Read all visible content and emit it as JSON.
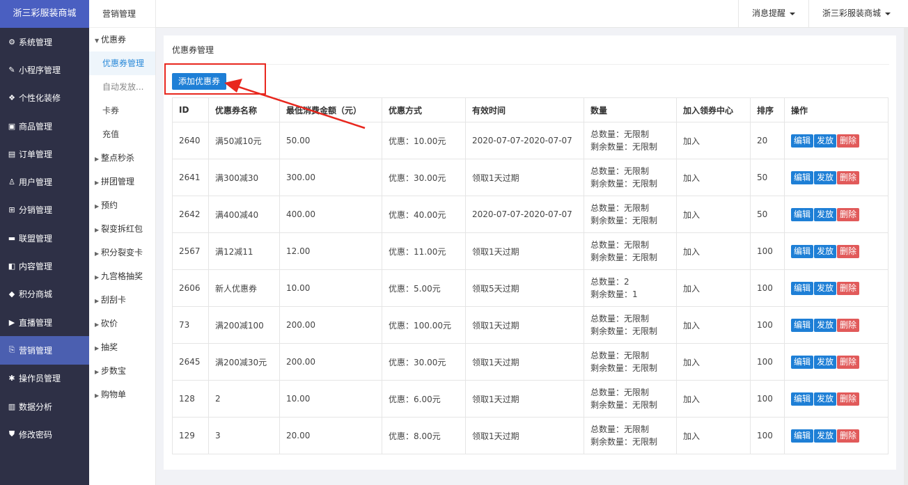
{
  "sidebar": {
    "brand": "浙三彩服装商城",
    "items": [
      {
        "label": "系统管理",
        "icon": "gear-icon",
        "glyph": "⚙"
      },
      {
        "label": "小程序管理",
        "icon": "link-icon",
        "glyph": "✎"
      },
      {
        "label": "个性化装修",
        "icon": "decorate-icon",
        "glyph": "❖"
      },
      {
        "label": "商品管理",
        "icon": "shop-icon",
        "glyph": "▣"
      },
      {
        "label": "订单管理",
        "icon": "order-icon",
        "glyph": "▤"
      },
      {
        "label": "用户管理",
        "icon": "user-icon",
        "glyph": "♙"
      },
      {
        "label": "分销管理",
        "icon": "sitemap-icon",
        "glyph": "⊞"
      },
      {
        "label": "联盟管理",
        "icon": "alliance-icon",
        "glyph": "▬"
      },
      {
        "label": "内容管理",
        "icon": "content-icon",
        "glyph": "◧"
      },
      {
        "label": "积分商城",
        "icon": "cube-icon",
        "glyph": "◆"
      },
      {
        "label": "直播管理",
        "icon": "play-icon",
        "glyph": "▶"
      },
      {
        "label": "营销管理",
        "icon": "marketing-icon",
        "glyph": "⎘"
      },
      {
        "label": "操作员管理",
        "icon": "cog-icon",
        "glyph": "✱"
      },
      {
        "label": "数据分析",
        "icon": "bar-chart-icon",
        "glyph": "▥"
      },
      {
        "label": "修改密码",
        "icon": "shield-icon",
        "glyph": "⛊"
      }
    ],
    "active_index": 11
  },
  "subnav": {
    "title": "营销管理",
    "items": [
      {
        "label": "优惠券",
        "type": "group",
        "expanded": true
      },
      {
        "label": "优惠券管理",
        "type": "child",
        "active": true
      },
      {
        "label": "自动发放...",
        "type": "child",
        "muted": true
      },
      {
        "label": "卡券",
        "type": "child"
      },
      {
        "label": "充值",
        "type": "child"
      },
      {
        "label": "整点秒杀",
        "type": "group"
      },
      {
        "label": "拼团管理",
        "type": "group"
      },
      {
        "label": "预约",
        "type": "group"
      },
      {
        "label": "裂变拆红包",
        "type": "group"
      },
      {
        "label": "积分裂变卡",
        "type": "group"
      },
      {
        "label": "九宫格抽奖",
        "type": "group"
      },
      {
        "label": "刮刮卡",
        "type": "group"
      },
      {
        "label": "砍价",
        "type": "group"
      },
      {
        "label": "抽奖",
        "type": "group"
      },
      {
        "label": "步数宝",
        "type": "group"
      },
      {
        "label": "购物单",
        "type": "group"
      }
    ]
  },
  "topbar": {
    "notifications": "消息提醒",
    "store": "浙三彩服装商城"
  },
  "panel": {
    "title": "优惠券管理",
    "add_button": "添加优惠券"
  },
  "table": {
    "headers": [
      "ID",
      "优惠券名称",
      "最低消费金额（元）",
      "优惠方式",
      "有效时间",
      "数量",
      "加入领券中心",
      "排序",
      "操作"
    ],
    "actions": {
      "edit": "编辑",
      "issue": "发放",
      "delete": "删除"
    },
    "rows": [
      {
        "id": "2640",
        "name": "满50减10元",
        "min": "50.00",
        "discount": "优惠：10.00元",
        "valid": "2020-07-07-2020-07-07",
        "total": "总数量：无限制",
        "remain": "剩余数量：无限制",
        "center": "加入",
        "sort": "20"
      },
      {
        "id": "2641",
        "name": "满300减30",
        "min": "300.00",
        "discount": "优惠：30.00元",
        "valid": "领取1天过期",
        "total": "总数量：无限制",
        "remain": "剩余数量：无限制",
        "center": "加入",
        "sort": "50"
      },
      {
        "id": "2642",
        "name": "满400减40",
        "min": "400.00",
        "discount": "优惠：40.00元",
        "valid": "2020-07-07-2020-07-07",
        "total": "总数量：无限制",
        "remain": "剩余数量：无限制",
        "center": "加入",
        "sort": "50"
      },
      {
        "id": "2567",
        "name": "满12减11",
        "min": "12.00",
        "discount": "优惠：11.00元",
        "valid": "领取1天过期",
        "total": "总数量：无限制",
        "remain": "剩余数量：无限制",
        "center": "加入",
        "sort": "100"
      },
      {
        "id": "2606",
        "name": "新人优惠券",
        "min": "10.00",
        "discount": "优惠：5.00元",
        "valid": "领取5天过期",
        "total": "总数量：2",
        "remain": "剩余数量：1",
        "center": "加入",
        "sort": "100"
      },
      {
        "id": "73",
        "name": "满200减100",
        "min": "200.00",
        "discount": "优惠：100.00元",
        "valid": "领取1天过期",
        "total": "总数量：无限制",
        "remain": "剩余数量：无限制",
        "center": "加入",
        "sort": "100"
      },
      {
        "id": "2645",
        "name": "满200减30元",
        "min": "200.00",
        "discount": "优惠：30.00元",
        "valid": "领取1天过期",
        "total": "总数量：无限制",
        "remain": "剩余数量：无限制",
        "center": "加入",
        "sort": "100"
      },
      {
        "id": "128",
        "name": "2",
        "min": "10.00",
        "discount": "优惠：6.00元",
        "valid": "领取1天过期",
        "total": "总数量：无限制",
        "remain": "剩余数量：无限制",
        "center": "加入",
        "sort": "100"
      },
      {
        "id": "129",
        "name": "3",
        "min": "20.00",
        "discount": "优惠：8.00元",
        "valid": "领取1天过期",
        "total": "总数量：无限制",
        "remain": "剩余数量：无限制",
        "center": "加入",
        "sort": "100"
      }
    ]
  },
  "colors": {
    "sidebar_bg": "#2e3046",
    "accent_blue": "#1e7fd6",
    "delete_red": "#e15a5a",
    "annotation_red": "#e8271e"
  }
}
